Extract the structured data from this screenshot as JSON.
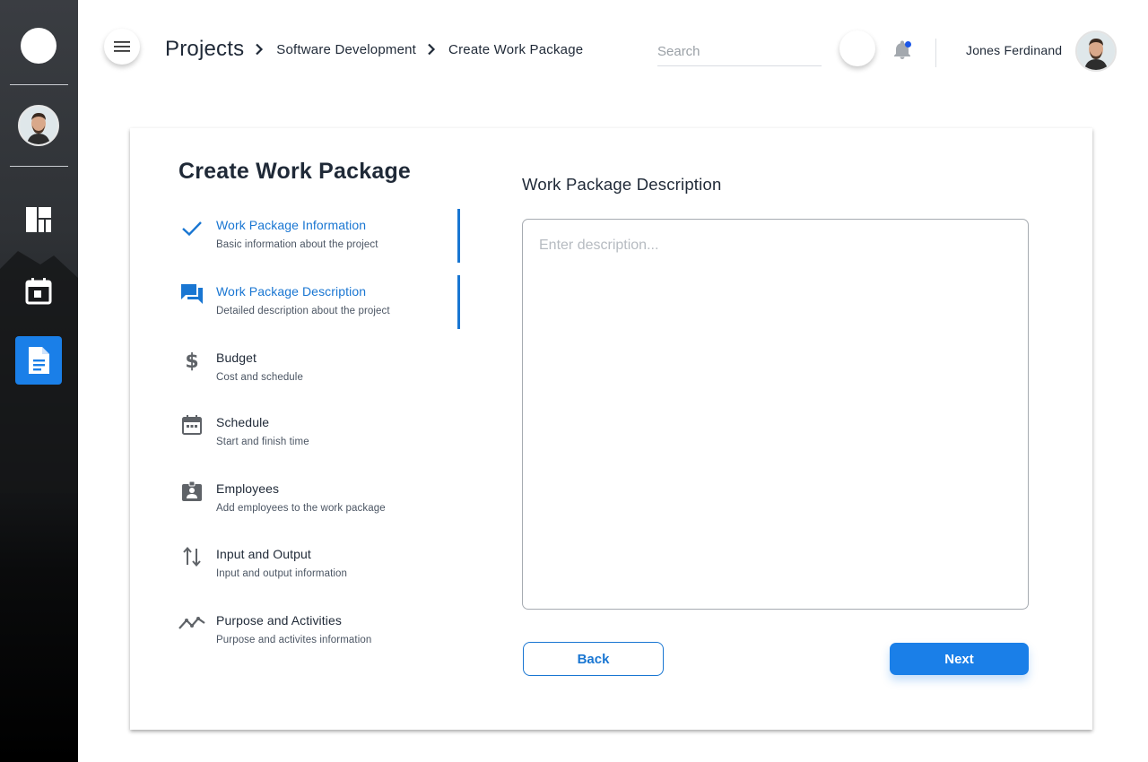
{
  "header": {
    "breadcrumb": {
      "root": "Projects",
      "level1": "Software Development",
      "level2": "Create Work Package"
    },
    "search_placeholder": "Search",
    "user_name": "Jones Ferdinand"
  },
  "card": {
    "title": "Create Work Package",
    "steps": [
      {
        "title": "Work Package Information",
        "subtitle": "Basic information about the project",
        "icon": "check-icon"
      },
      {
        "title": "Work Package Description",
        "subtitle": "Detailed description about the project",
        "icon": "chat-icon"
      },
      {
        "title": "Budget",
        "subtitle": "Cost and schedule",
        "icon": "dollar-icon"
      },
      {
        "title": "Schedule",
        "subtitle": "Start and finish time",
        "icon": "calendar-icon"
      },
      {
        "title": "Employees",
        "subtitle": "Add employees to the work package",
        "icon": "badge-icon"
      },
      {
        "title": "Input and Output",
        "subtitle": "Input and output information",
        "icon": "swap-icon"
      },
      {
        "title": "Purpose and Activities",
        "subtitle": "Purpose and activites information",
        "icon": "trend-icon"
      }
    ],
    "description": {
      "title": "Work Package Description",
      "placeholder": "Enter description..."
    },
    "buttons": {
      "back": "Back",
      "next": "Next"
    }
  },
  "colors": {
    "accent": "#1a7fe8",
    "active_text": "#1976d2",
    "sidebar_active": "#1a7fe8"
  }
}
